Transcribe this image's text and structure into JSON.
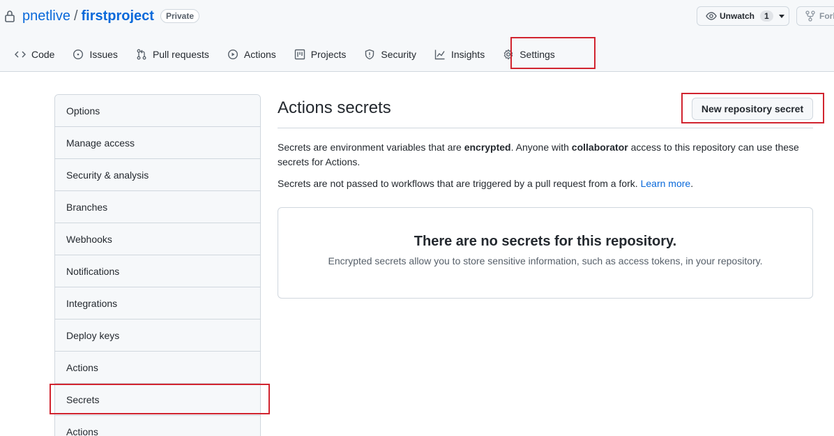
{
  "repo": {
    "owner": "pnetlive",
    "separator": "/",
    "name": "firstproject",
    "visibility": "Private"
  },
  "actions_bar": {
    "watch_label": "Unwatch",
    "watch_count": "1",
    "fork_label": "Fork"
  },
  "nav": {
    "tabs": [
      {
        "label": "Code",
        "icon": "code-icon"
      },
      {
        "label": "Issues",
        "icon": "issue-icon"
      },
      {
        "label": "Pull requests",
        "icon": "pull-request-icon"
      },
      {
        "label": "Actions",
        "icon": "play-icon"
      },
      {
        "label": "Projects",
        "icon": "project-icon"
      },
      {
        "label": "Security",
        "icon": "shield-icon"
      },
      {
        "label": "Insights",
        "icon": "graph-icon"
      },
      {
        "label": "Settings",
        "icon": "gear-icon"
      }
    ]
  },
  "sidebar": {
    "items": [
      {
        "label": "Options"
      },
      {
        "label": "Manage access"
      },
      {
        "label": "Security & analysis"
      },
      {
        "label": "Branches"
      },
      {
        "label": "Webhooks"
      },
      {
        "label": "Notifications"
      },
      {
        "label": "Integrations"
      },
      {
        "label": "Deploy keys"
      },
      {
        "label": "Actions"
      },
      {
        "label": "Secrets"
      },
      {
        "label": "Actions"
      }
    ]
  },
  "main": {
    "title": "Actions secrets",
    "new_secret_button": "New repository secret",
    "desc1_a": "Secrets are environment variables that are ",
    "desc1_b": "encrypted",
    "desc1_c": ". Anyone with ",
    "desc1_d": "collaborator",
    "desc1_e": " access to this repository can use these secrets for Actions.",
    "desc2_a": "Secrets are not passed to workflows that are triggered by a pull request from a fork. ",
    "desc2_link": "Learn more",
    "desc2_end": ".",
    "blank_title": "There are no secrets for this repository.",
    "blank_sub": "Encrypted secrets allow you to store sensitive information, such as access tokens, in your repository."
  }
}
